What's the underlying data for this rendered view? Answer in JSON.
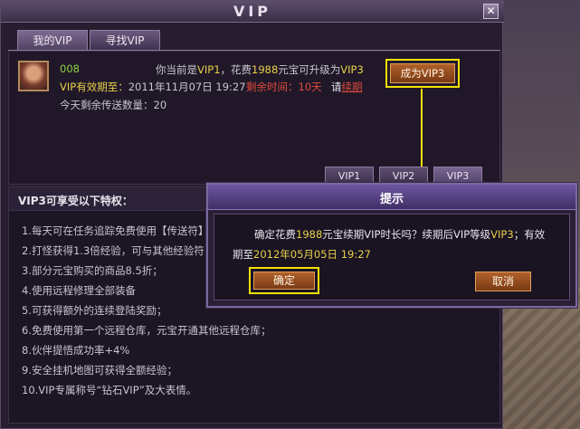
{
  "window": {
    "title": "VIP",
    "close_glyph": "✕"
  },
  "tabs": [
    {
      "label": "我的VIP"
    },
    {
      "label": "寻找VIP"
    }
  ],
  "profile": {
    "name": "008",
    "vip_intro": "你当前是",
    "vip_current": "VIP1",
    "cost_intro": "，花费",
    "cost_amount": "1988",
    "cost_unit": "元宝可升级为",
    "vip_target": "VIP3",
    "expire_label": "VIP有效期至：",
    "expire_date": "2011年11月07日 19:27",
    "remain_label": "剩余时间：",
    "remain_days": "10天",
    "renew_prompt": "请",
    "renew_link": "续期",
    "transfer_label": "今天剩余传送数量：",
    "transfer_count": "20",
    "become_button": "成为VIP3"
  },
  "vip_tabs": [
    {
      "label": "VIP1"
    },
    {
      "label": "VIP2"
    },
    {
      "label": "VIP3"
    }
  ],
  "privileges": {
    "title": "VIP3可享受以下特权：",
    "lines": [
      "1.每天可在任务追踪免费使用【传送符】",
      "2.打怪获得1.3倍经验，可与其他经验符",
      "3.部分元宝购买的商品8.5折；",
      "4.使用远程修理全部装备",
      "5.可获得额外的连续登陆奖励；",
      "6.免费使用第一个远程仓库，元宝开通其他远程仓库；",
      "8.伙伴提悟成功率+4%",
      "9.安全挂机地图可获得全额经验；",
      "10.VIP专属称号“钻石VIP”及大表情。"
    ],
    "line2_highlight": "1.3",
    "line3_link": "购买",
    "line3_highlight": "8.5折",
    "line4_link": "修理全部装备",
    "line5_link": "连续登陆奖励",
    "line6_link": "远程仓库",
    "line8_link": "提悟"
  },
  "dialog": {
    "title": "提示",
    "msg_prefix": "确定花费",
    "msg_amount": "1988",
    "msg_mid": "元宝续期VIP时长吗？续期后VIP等级",
    "msg_level": "VIP3",
    "msg_tail": "；有效",
    "msg_line2_prefix": "期至",
    "msg_date": "2012年05月05日 19:27",
    "confirm_label": "确定",
    "cancel_label": "取消"
  },
  "colors": {
    "highlight_green": "#8fd14a",
    "highlight_yellow": "#e8d04a",
    "highlight_red": "#e04a3a",
    "outline_yellow": "#f2e000",
    "button_brown": "#9a4a1e"
  }
}
